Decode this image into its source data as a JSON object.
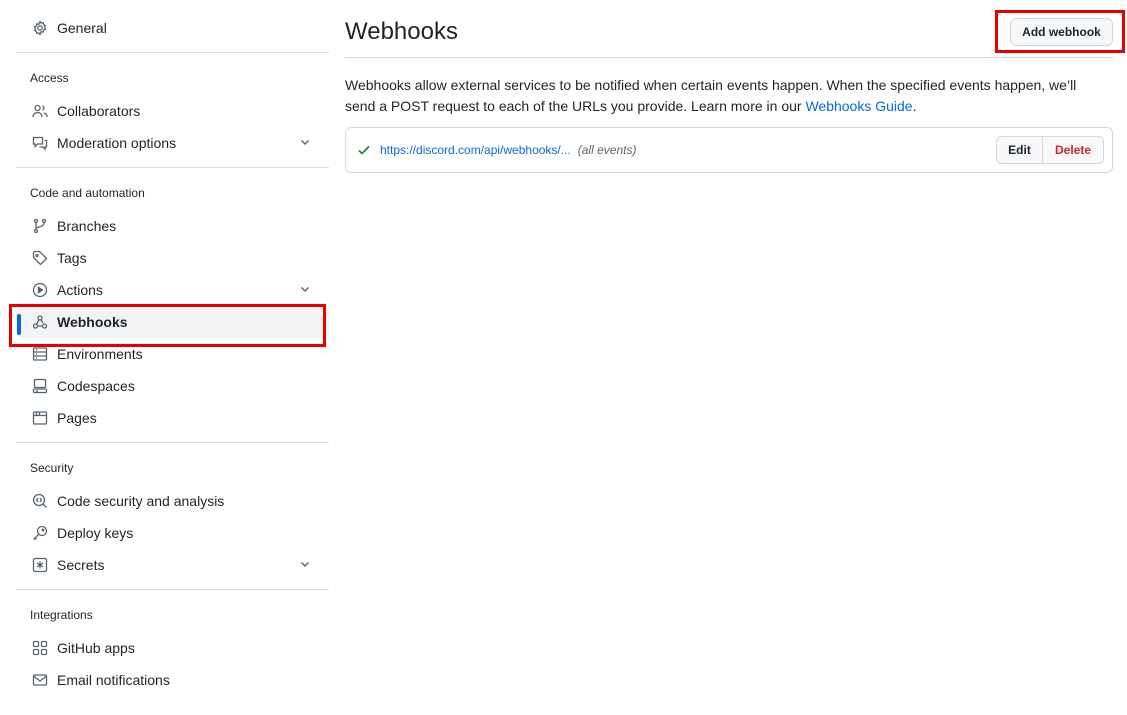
{
  "sidebar": {
    "general": {
      "label": "General",
      "icon": "gear-icon"
    },
    "groups": [
      {
        "title": "Access",
        "items": [
          {
            "label": "Collaborators",
            "icon": "people-icon",
            "expandable": false
          },
          {
            "label": "Moderation options",
            "icon": "comment-discussion-icon",
            "expandable": true
          }
        ]
      },
      {
        "title": "Code and automation",
        "items": [
          {
            "label": "Branches",
            "icon": "git-branch-icon",
            "expandable": false
          },
          {
            "label": "Tags",
            "icon": "tag-icon",
            "expandable": false
          },
          {
            "label": "Actions",
            "icon": "play-icon",
            "expandable": true
          },
          {
            "label": "Webhooks",
            "icon": "webhook-icon",
            "expandable": false,
            "active": true
          },
          {
            "label": "Environments",
            "icon": "server-icon",
            "expandable": false
          },
          {
            "label": "Codespaces",
            "icon": "codespaces-icon",
            "expandable": false
          },
          {
            "label": "Pages",
            "icon": "browser-icon",
            "expandable": false
          }
        ]
      },
      {
        "title": "Security",
        "items": [
          {
            "label": "Code security and analysis",
            "icon": "codescan-icon",
            "expandable": false
          },
          {
            "label": "Deploy keys",
            "icon": "key-icon",
            "expandable": false
          },
          {
            "label": "Secrets",
            "icon": "key-asterisk-icon",
            "expandable": true
          }
        ]
      },
      {
        "title": "Integrations",
        "items": [
          {
            "label": "GitHub apps",
            "icon": "apps-icon",
            "expandable": false
          },
          {
            "label": "Email notifications",
            "icon": "mail-icon",
            "expandable": false
          }
        ]
      }
    ]
  },
  "main": {
    "title": "Webhooks",
    "add_button": "Add webhook",
    "description_text": "Webhooks allow external services to be notified when certain events happen. When the specified events happen, we’ll send a POST request to each of the URLs you provide. Learn more in our ",
    "description_link": "Webhooks Guide",
    "description_end": ".",
    "webhooks": [
      {
        "status": "success",
        "url": "https://discord.com/api/webhooks/...",
        "events": "(all events)",
        "edit_label": "Edit",
        "delete_label": "Delete"
      }
    ]
  },
  "colors": {
    "accent": "#0969da",
    "danger": "#d1242f",
    "success": "#1a7f37",
    "highlight": "#e60000"
  }
}
